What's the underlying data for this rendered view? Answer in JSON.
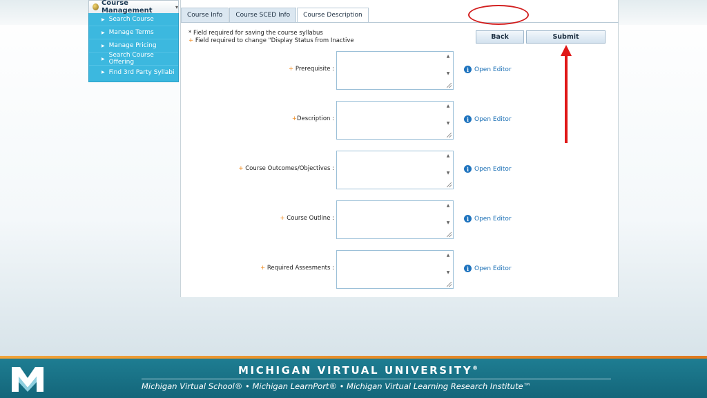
{
  "sidebar": {
    "header": "Course Management",
    "items": [
      {
        "label": "Search Course"
      },
      {
        "label": "Manage Terms"
      },
      {
        "label": "Manage Pricing"
      },
      {
        "label": "Search Course Offering"
      },
      {
        "label": "Find 3rd Party Syllabi"
      }
    ]
  },
  "tabs": [
    {
      "label": "Course Info"
    },
    {
      "label": "Course SCED Info"
    },
    {
      "label": "Course Description",
      "active": true
    }
  ],
  "notes": {
    "line1": "* Field required for saving the course syllabus",
    "line2_marker": "+",
    "line2": " Field required to change \"Display Status from Inactive"
  },
  "buttons": {
    "back": "Back",
    "submit": "Submit"
  },
  "fields": [
    {
      "marker": "+",
      "label": " Prerequisite   :"
    },
    {
      "marker": "+",
      "label": "Description :"
    },
    {
      "marker": "+",
      "label": " Course Outcomes/Objectives :"
    },
    {
      "marker": "+",
      "label": " Course Outline :"
    },
    {
      "marker": "+",
      "label": " Required Assesments :"
    }
  ],
  "editor_link_label": "Open Editor",
  "footer": {
    "title": "MICHIGAN VIRTUAL UNIVERSITY",
    "title_mark": "®",
    "subtitle": "Michigan Virtual School® • Michigan LearnPort® • Michigan Virtual Learning Research Institute™"
  },
  "colors": {
    "sidebar_bg": "#3cb8df",
    "accent_orange": "#f08a1c",
    "footer_bg": "#1e7d92",
    "annotation_red": "#d21f1f",
    "link_blue": "#1a6fb5"
  },
  "icons": [
    "course-management-icon",
    "info-icon",
    "chevron-right-icon",
    "scroll-up-icon",
    "scroll-down-icon",
    "resize-grip-icon",
    "mvu-logo"
  ]
}
